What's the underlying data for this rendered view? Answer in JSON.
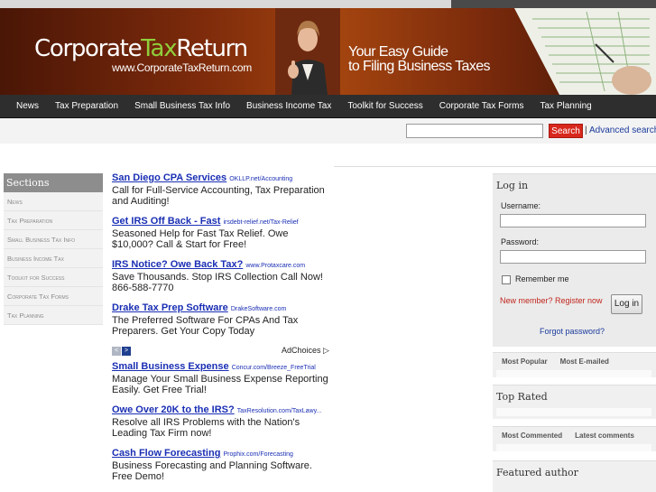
{
  "banner": {
    "logo_corporate": "Corporate",
    "logo_tax": "Tax",
    "logo_return": "Return",
    "logo_url": "www.CorporateTaxReturn.com",
    "tagline_1": "Your Easy Guide",
    "tagline_2": "to Filing Business Taxes"
  },
  "nav": {
    "items": [
      "News",
      "Tax Preparation",
      "Small Business Tax Info",
      "Business Income Tax",
      "Toolkit for Success",
      "Corporate Tax Forms",
      "Tax Planning"
    ]
  },
  "search": {
    "value": "",
    "button": "Search",
    "separator": "|",
    "advanced": "Advanced search"
  },
  "sections": {
    "title": "Sections",
    "items": [
      "News",
      "Tax Preparation",
      "Small Business Tax Info",
      "Business Income Tax",
      "Toolkit for Success",
      "Corporate Tax Forms",
      "Tax Planning"
    ]
  },
  "ads": {
    "adchoices": "AdChoices",
    "prev": "<",
    "next": ">",
    "items": [
      {
        "title": "San Diego CPA Services",
        "url": "OKLLP.net/Accounting",
        "desc": "Call for Full-Service Accounting, Tax Preparation and Auditing!"
      },
      {
        "title": "Get IRS Off Back - Fast",
        "url": "irsdebt-relief.net/Tax-Relief",
        "desc": "Seasoned Help for Fast Tax Relief. Owe $10,000? Call & Start for Free!"
      },
      {
        "title": "IRS Notice? Owe Back Tax?",
        "url": "www.Protaxcare.com",
        "desc": "Save Thousands. Stop IRS Collection Call Now! 866-588-7770"
      },
      {
        "title": "Drake Tax Prep Software",
        "url": "DrakeSoftware.com",
        "desc": "The Preferred Software For CPAs And Tax Preparers. Get Your Copy Today"
      },
      {
        "title": "Small Business Expense",
        "url": "Concur.com/Breeze_FreeTrial",
        "desc": "Manage Your Small Business Expense Reporting Easily. Get Free Trial!"
      },
      {
        "title": "Owe Over 20K to the IRS?",
        "url": "TaxResolution.com/TaxLawy...",
        "desc": "Resolve all IRS Problems with the Nation's Leading Tax Firm now!"
      },
      {
        "title": "Cash Flow Forecasting",
        "url": "Prophix.com/Forecasting",
        "desc": "Business Forecasting and Planning Software. Free Demo!"
      }
    ]
  },
  "login": {
    "title": "Log in",
    "username_label": "Username:",
    "username_value": "",
    "password_label": "Password:",
    "password_value": "",
    "remember_label": "Remember me",
    "remember_checked": false,
    "new_member": "New member? Register now",
    "login_button": "Log in",
    "forgot": "Forgot password?"
  },
  "popular": {
    "tab1": "Most Popular",
    "tab2": "Most E-mailed"
  },
  "top_rated": {
    "title": "Top Rated"
  },
  "commented": {
    "tab1": "Most Commented",
    "tab2": "Latest comments"
  },
  "featured": {
    "title": "Featured author"
  }
}
